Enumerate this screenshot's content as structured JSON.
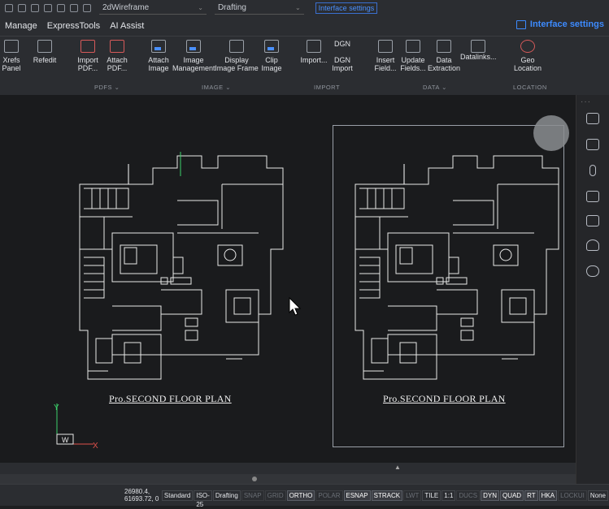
{
  "qat": {
    "workspace": "2dWireframe",
    "style": "Drafting",
    "link": "Interface settings"
  },
  "tabs": [
    "Manage",
    "ExpressTools",
    "AI Assist"
  ],
  "interface_settings": "Interface settings",
  "ribbon": {
    "buttons": [
      {
        "l1": "Xrefs",
        "l2": "Panel"
      },
      {
        "l1": "Refedit",
        "l2": ""
      },
      {
        "l1": "Import",
        "l2": "PDF..."
      },
      {
        "l1": "Attach",
        "l2": "PDF..."
      },
      {
        "l1": "Attach",
        "l2": "Image"
      },
      {
        "l1": "Image",
        "l2": "Management"
      },
      {
        "l1": "Display",
        "l2": "Image Frame"
      },
      {
        "l1": "Clip",
        "l2": "Image"
      },
      {
        "l1": "Import...",
        "l2": ""
      },
      {
        "l1": "DGN",
        "l2": "Import"
      },
      {
        "l1": "Insert",
        "l2": "Field..."
      },
      {
        "l1": "Update",
        "l2": "Fields..."
      },
      {
        "l1": "Data",
        "l2": "Extraction"
      },
      {
        "l1": "Datalinks...",
        "l2": ""
      },
      {
        "l1": "Geo",
        "l2": "Location"
      }
    ],
    "dgn_top": "DGN",
    "groups": {
      "pdfs": "PDFS",
      "image": "IMAGE",
      "import": "IMPORT",
      "data": "DATA",
      "location": "LOCATION"
    }
  },
  "drawing": {
    "title_left": "Pro.SECOND FLOOR PLAN",
    "title_right": "Pro.SECOND FLOOR PLAN"
  },
  "ucs": {
    "y": "Y",
    "w": "W",
    "x": "X"
  },
  "status": {
    "coord": "26980.4, 61693.72, 0",
    "items": [
      {
        "t": "Standard",
        "s": "n"
      },
      {
        "t": "ISO-25",
        "s": "n"
      },
      {
        "t": "Drafting",
        "s": "n"
      },
      {
        "t": "SNAP",
        "s": "off"
      },
      {
        "t": "GRID",
        "s": "off"
      },
      {
        "t": "ORTHO",
        "s": "on"
      },
      {
        "t": "POLAR",
        "s": "off"
      },
      {
        "t": "ESNAP",
        "s": "on"
      },
      {
        "t": "STRACK",
        "s": "on"
      },
      {
        "t": "LWT",
        "s": "off"
      },
      {
        "t": "TILE",
        "s": "n"
      },
      {
        "t": "1:1",
        "s": "n"
      },
      {
        "t": "DUCS",
        "s": "off"
      },
      {
        "t": "DYN",
        "s": "on"
      },
      {
        "t": "QUAD",
        "s": "on"
      },
      {
        "t": "RT",
        "s": "on"
      },
      {
        "t": "HKA",
        "s": "on"
      },
      {
        "t": "LOCKUI",
        "s": "off"
      },
      {
        "t": "None",
        "s": "n"
      }
    ]
  }
}
